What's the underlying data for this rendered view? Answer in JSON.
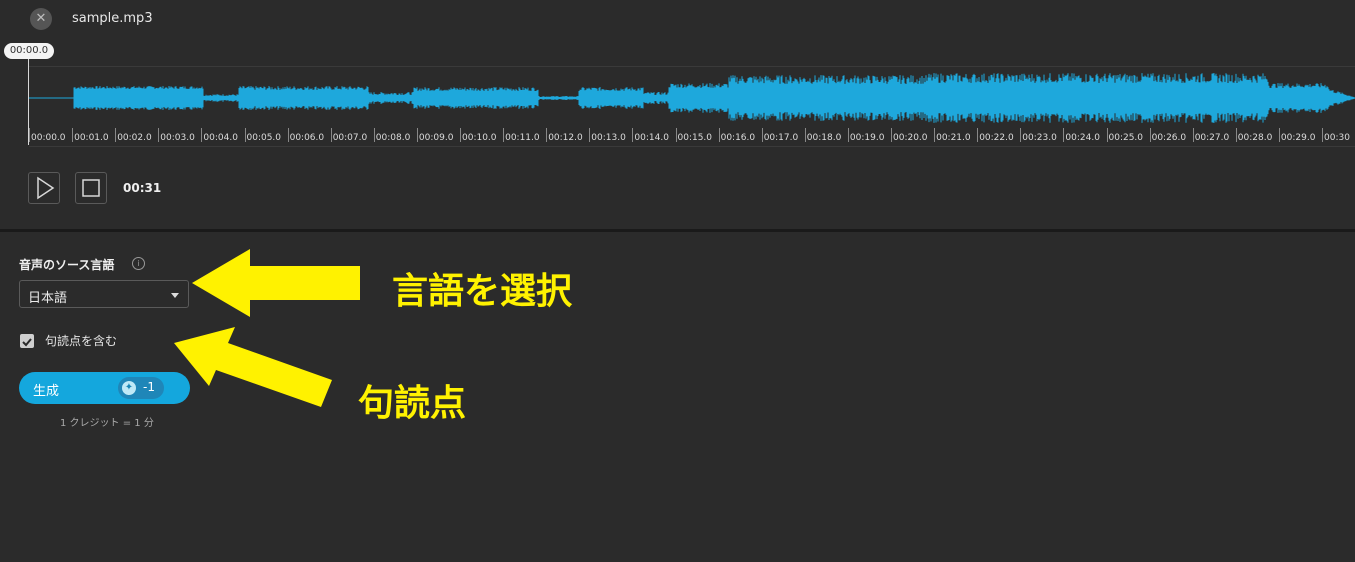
{
  "player": {
    "close_icon": "close-icon",
    "filename": "sample.mp3",
    "current_time": "00:00.0",
    "duration": "00:31",
    "play_icon": "play-icon",
    "stop_icon": "stop-icon",
    "waveform_color": "#1ea8dc",
    "ruler_labels": [
      "00:00.0",
      "00:01.0",
      "00:02.0",
      "00:03.0",
      "00:04.0",
      "00:05.0",
      "00:06.0",
      "00:07.0",
      "00:08.0",
      "00:09.0",
      "00:10.0",
      "00:11.0",
      "00:12.0",
      "00:13.0",
      "00:14.0",
      "00:15.0",
      "00:16.0",
      "00:17.0",
      "00:18.0",
      "00:19.0",
      "00:20.0",
      "00:21.0",
      "00:22.0",
      "00:23.0",
      "00:24.0",
      "00:25.0",
      "00:26.0",
      "00:27.0",
      "00:28.0",
      "00:29.0",
      "00:30"
    ]
  },
  "settings": {
    "source_language_label": "音声のソース言語",
    "info_icon": "info-icon",
    "language_selected": "日本語",
    "punctuation_label": "句読点を含む",
    "punctuation_checked": true,
    "generate_label": "生成",
    "credit_cost": "-1",
    "credit_note": "1 クレジット = 1 分",
    "accent_color": "#14a7dd"
  },
  "annotations": {
    "language_callout": "言語を選択",
    "punctuation_callout": "句読点",
    "arrow_color": "#fff200"
  }
}
